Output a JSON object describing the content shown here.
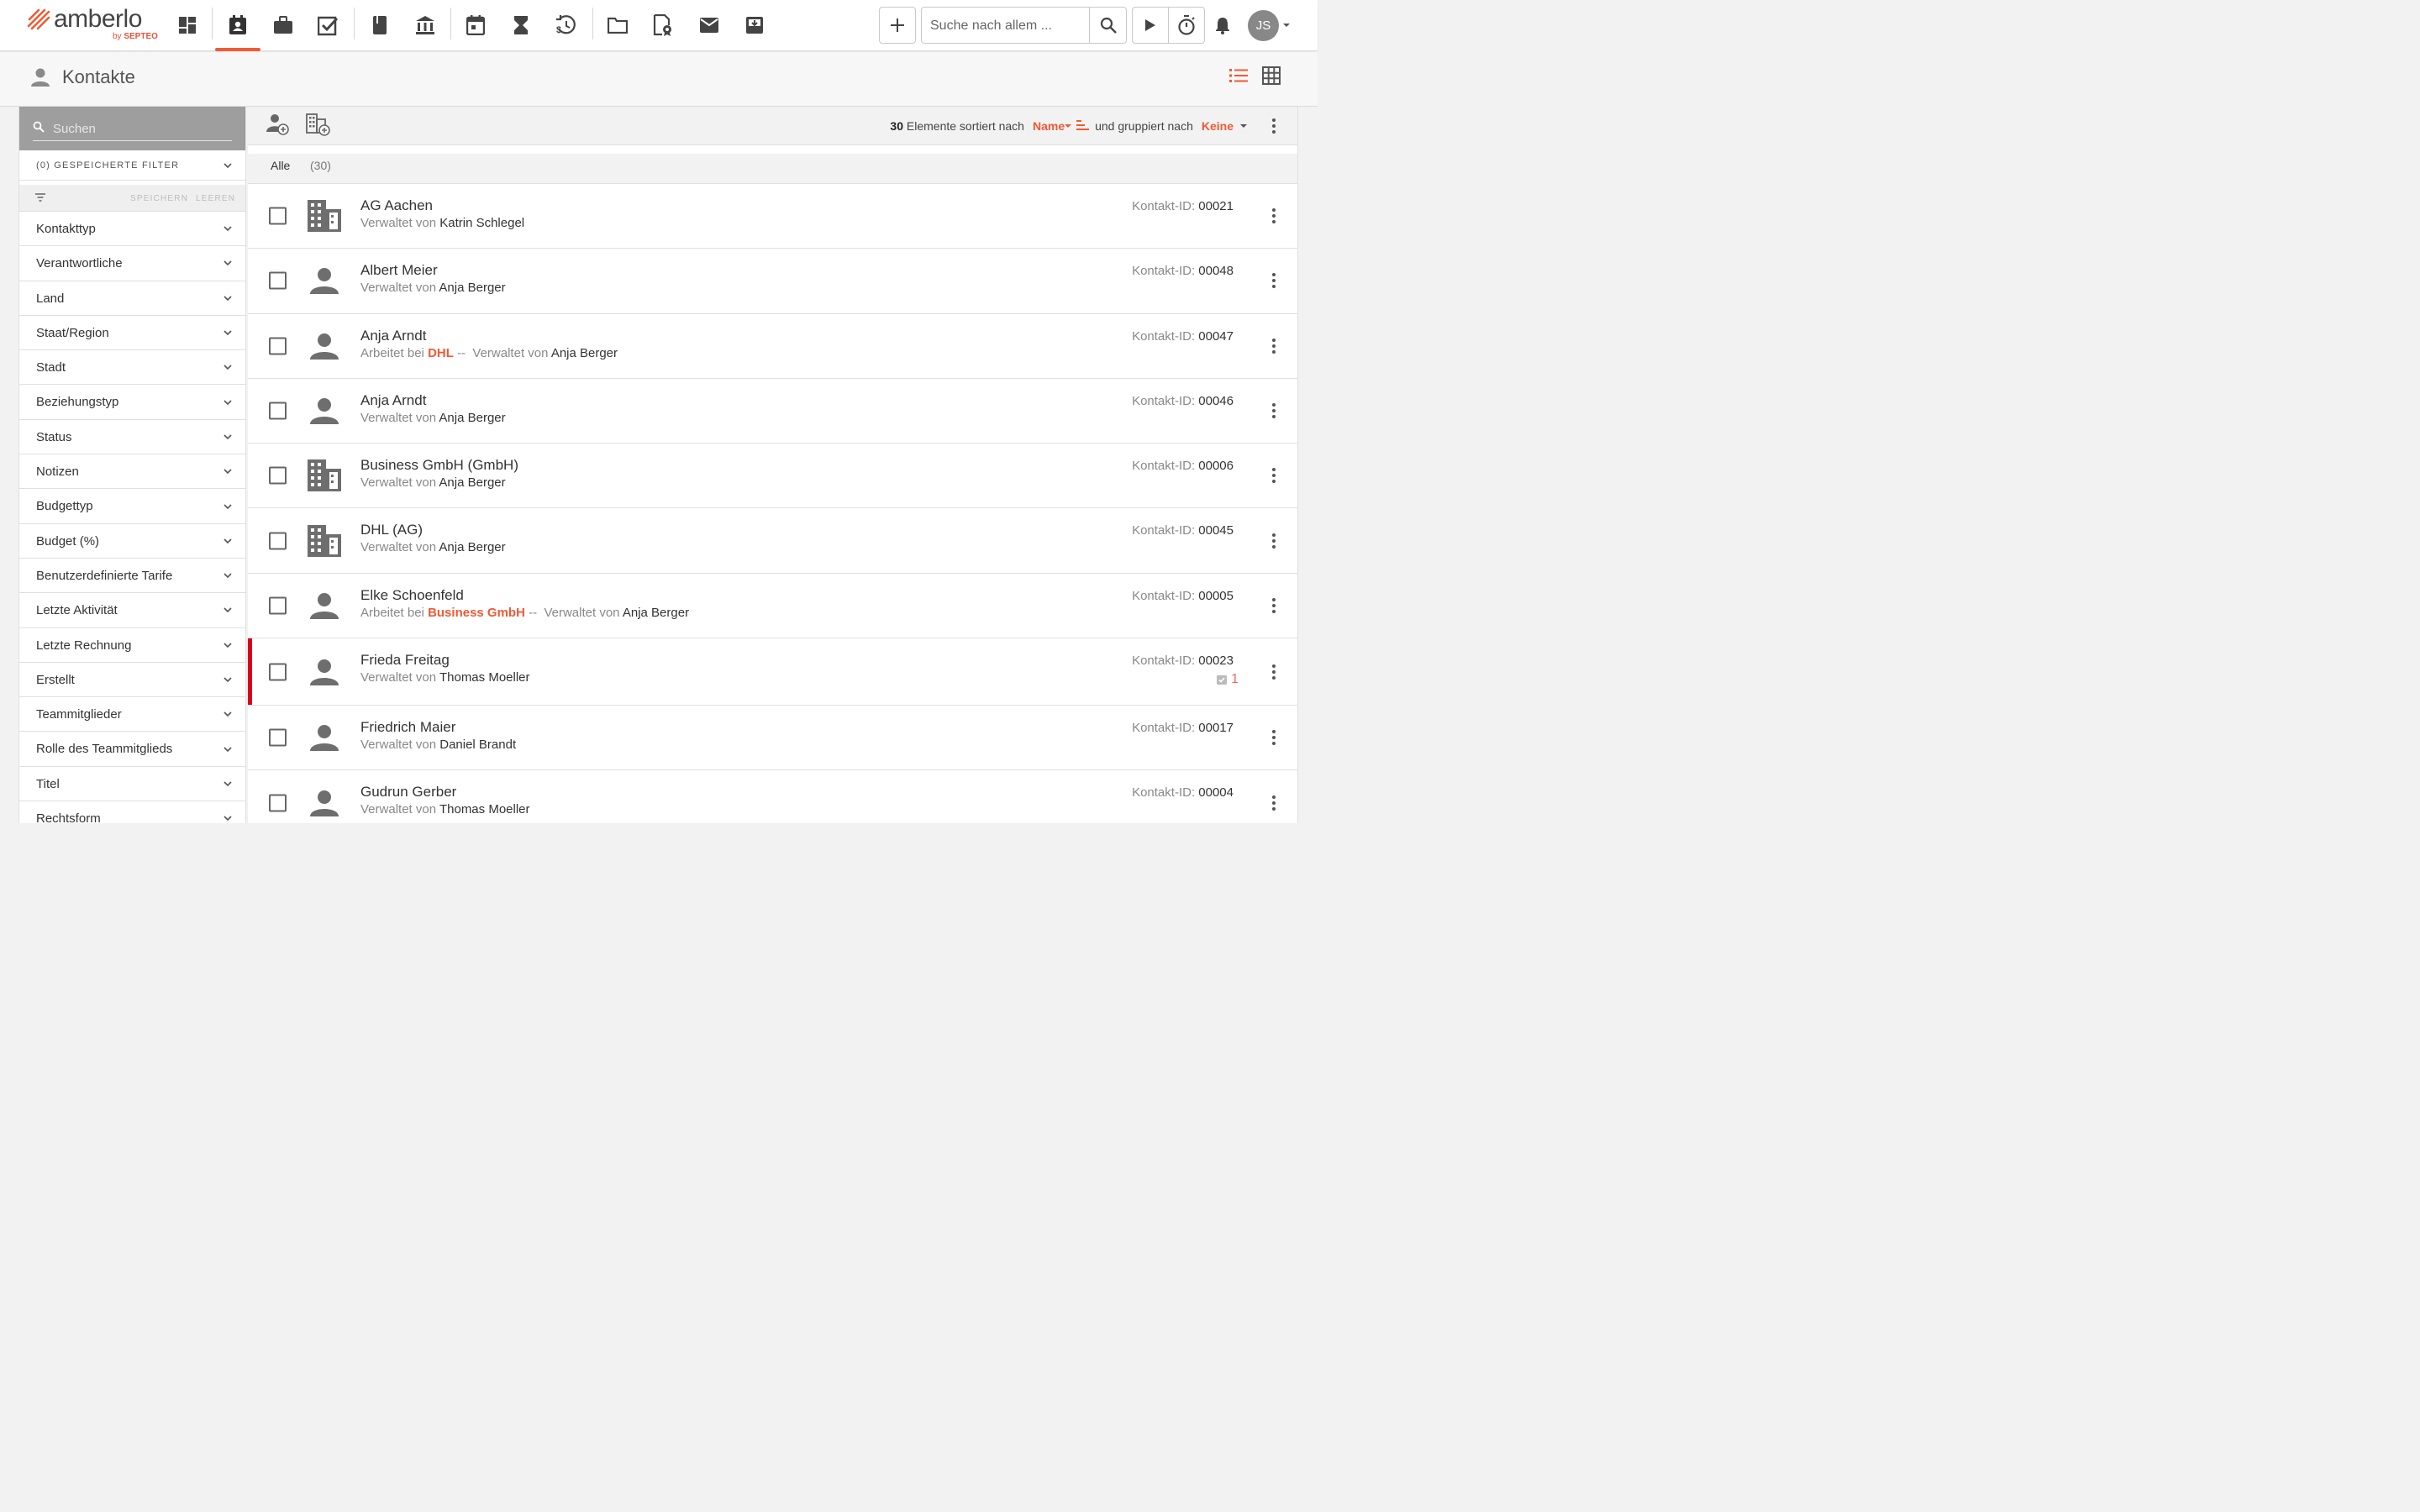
{
  "brand": {
    "name": "amberlo",
    "sub_prefix": "by",
    "sub_brand": "SEPTEO"
  },
  "colors": {
    "accent": "#ef5a35",
    "flag": "#d9001b"
  },
  "topbar": {
    "nav_icons": [
      "dashboard-icon",
      "contacts-icon",
      "briefcase-icon",
      "tasks-icon",
      "book-icon",
      "bank-icon",
      "calendar-icon",
      "hourglass-icon",
      "time-money-icon",
      "folder-icon",
      "document-seal-icon",
      "mail-icon",
      "inbox-icon"
    ],
    "search_placeholder": "Suche nach allem ...",
    "user_initials": "JS"
  },
  "page": {
    "title": "Kontakte"
  },
  "sidebar": {
    "search_placeholder": "Suchen",
    "saved_filter": "(0) GESPEICHERTE FILTER",
    "save_label": "SPEICHERN",
    "clear_label": "LEEREN",
    "filters": [
      "Kontakttyp",
      "Verantwortliche",
      "Land",
      "Staat/Region",
      "Stadt",
      "Beziehungstyp",
      "Status",
      "Notizen",
      "Budgettyp",
      "Budget (%)",
      "Benutzerdefinierte Tarife",
      "Letzte Aktivität",
      "Letzte Rechnung",
      "Erstellt",
      "Teammitglieder",
      "Rolle des Teammitglieds",
      "Titel",
      "Rechtsform"
    ]
  },
  "list": {
    "count": "30",
    "count_text": "Elemente sortiert nach",
    "sort_by": "Name",
    "group_text": "und gruppiert nach",
    "group_by": "Keine",
    "group_label": "Alle",
    "group_count": "(30)",
    "id_label": "Kontakt-ID:",
    "managed_label": "Verwaltet von",
    "works_label": "Arbeitet bei",
    "separator": "--",
    "rows": [
      {
        "type": "company",
        "name": "AG Aachen",
        "employer": "",
        "manager": "Katrin Schlegel",
        "id": "00021"
      },
      {
        "type": "person",
        "name": "Albert Meier",
        "employer": "",
        "manager": "Anja Berger",
        "id": "00048"
      },
      {
        "type": "person",
        "name": "Anja Arndt",
        "employer": "DHL",
        "manager": "Anja Berger",
        "id": "00047"
      },
      {
        "type": "person",
        "name": "Anja Arndt",
        "employer": "",
        "manager": "Anja Berger",
        "id": "00046"
      },
      {
        "type": "company",
        "name": "Business GmbH (GmbH)",
        "employer": "",
        "manager": "Anja Berger",
        "id": "00006"
      },
      {
        "type": "company",
        "name": "DHL (AG)",
        "employer": "",
        "manager": "Anja Berger",
        "id": "00045"
      },
      {
        "type": "person",
        "name": "Elke Schoenfeld",
        "employer": "Business GmbH",
        "manager": "Anja Berger",
        "id": "00005"
      },
      {
        "type": "person",
        "name": "Frieda Freitag",
        "employer": "",
        "manager": "Thomas Moeller",
        "id": "00023",
        "flag": true,
        "tasks": "1"
      },
      {
        "type": "person",
        "name": "Friedrich Maier",
        "employer": "",
        "manager": "Daniel Brandt",
        "id": "00017"
      },
      {
        "type": "person",
        "name": "Gudrun Gerber",
        "employer": "",
        "manager": "Thomas Moeller",
        "id": "00004"
      }
    ]
  }
}
